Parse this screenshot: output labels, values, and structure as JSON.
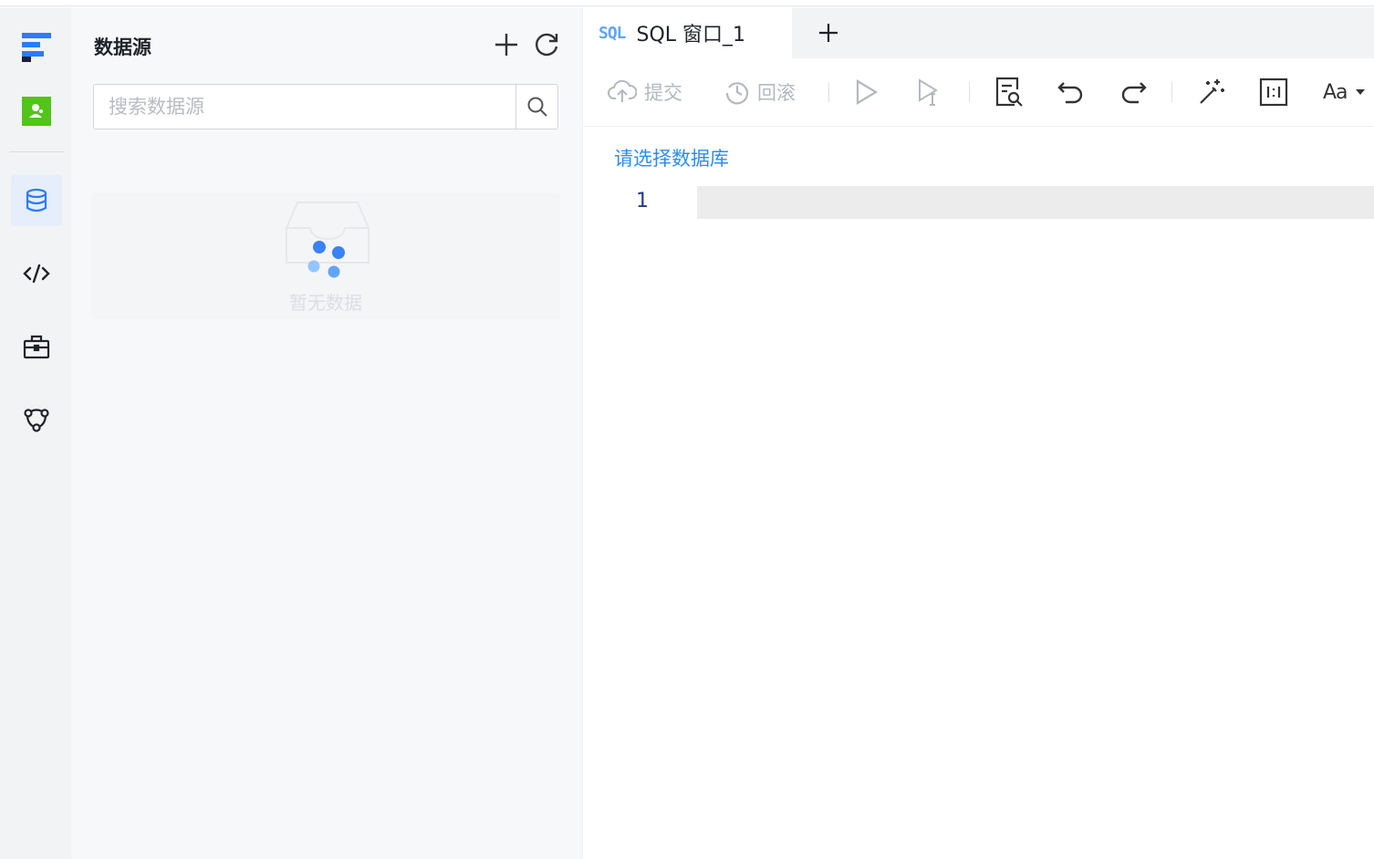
{
  "colors": {
    "accent": "#2d8cf0",
    "nav_bg": "#f2f3f5",
    "panel_bg": "#f7f8fa",
    "logo_green": "#52c41a"
  },
  "nav": {
    "items": [
      {
        "icon": "app-logo-icon"
      },
      {
        "icon": "user-avatar-icon"
      },
      {
        "icon": "database-icon",
        "active": true
      },
      {
        "icon": "code-icon"
      },
      {
        "icon": "toolbox-icon"
      },
      {
        "icon": "cluster-icon"
      }
    ]
  },
  "sidebar": {
    "title": "数据源",
    "search_placeholder": "搜索数据源",
    "empty_text": "暂无数据"
  },
  "editor": {
    "tab_badge": "SQL",
    "tab_label": "SQL 窗口_1",
    "toolbar": {
      "submit_label": "提交",
      "rollback_label": "回滚",
      "font_label": "Aa"
    },
    "select_db_text": "请选择数据库",
    "line_number": "1"
  }
}
